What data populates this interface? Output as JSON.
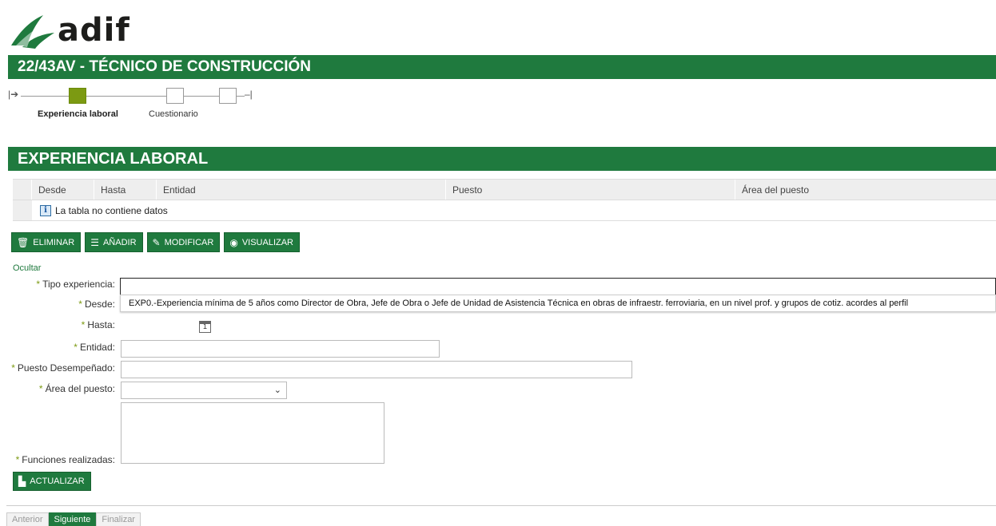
{
  "brand": {
    "name": "adif",
    "color": "#1f7a3e"
  },
  "page_title": "22/43AV - TÉCNICO DE CONSTRUCCIÓN",
  "stepper": {
    "steps": [
      {
        "label": "Experiencia laboral",
        "active": true
      },
      {
        "label": "Cuestionario",
        "active": false
      },
      {
        "label": "",
        "active": false
      }
    ]
  },
  "section_title": "EXPERIENCIA LABORAL",
  "table": {
    "columns": [
      "Desde",
      "Hasta",
      "Entidad",
      "Puesto",
      "Área del puesto"
    ],
    "empty_message": "La tabla no contiene datos"
  },
  "toolbar": {
    "delete": "ELIMINAR",
    "add": "AÑADIR",
    "edit": "MODIFICAR",
    "view": "VISUALIZAR"
  },
  "hide_link": "Ocultar",
  "form": {
    "tipo_experiencia": {
      "label": "Tipo experiencia:",
      "value": ""
    },
    "dropdown_option": "EXP0.-Experiencia mínima de 5 años como Director de Obra, Jefe de Obra o Jefe de Unidad de Asistencia Técnica en obras de infraestr. ferroviaria, en un nivel prof. y grupos de cotiz. acordes al perfil",
    "desde": {
      "label": "Desde:",
      "value": ""
    },
    "hasta": {
      "label": "Hasta:",
      "value": ""
    },
    "entidad": {
      "label": "Entidad:",
      "value": ""
    },
    "puesto": {
      "label": "Puesto Desempeñado:",
      "value": ""
    },
    "area": {
      "label": "Área del puesto:",
      "value": ""
    },
    "funciones": {
      "label": "Funciones realizadas:",
      "value": ""
    },
    "required_mark": "*",
    "calendar_day": "1"
  },
  "update_button": "ACTUALIZAR",
  "navigation": {
    "previous": "Anterior",
    "next": "Siguiente",
    "finish": "Finalizar"
  }
}
